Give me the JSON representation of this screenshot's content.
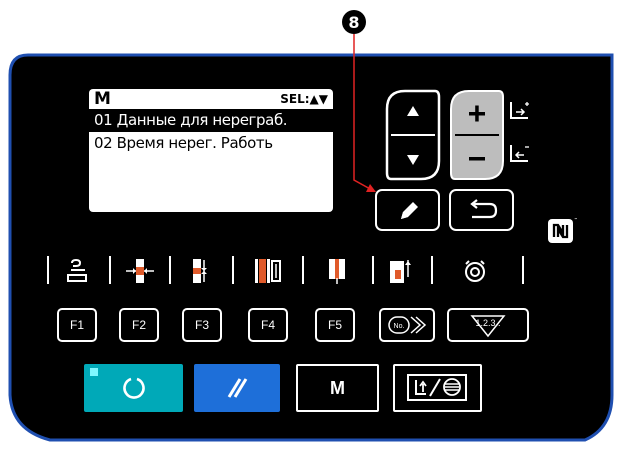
{
  "callout": {
    "number": "8"
  },
  "lcd": {
    "mode": "M",
    "sel_label": "SEL:▲▼",
    "rows": [
      {
        "text": "01 Данные для нерегpаб."
      },
      {
        "text": "02 Время нерег. Работь"
      }
    ]
  },
  "fkeys": [
    {
      "label": "F1"
    },
    {
      "label": "F2"
    },
    {
      "label": "F3"
    },
    {
      "label": "F4"
    },
    {
      "label": "F5"
    }
  ],
  "no_key": {
    "label": "No."
  },
  "counter_key": {
    "label": "1.2.3.."
  },
  "m_key": {
    "label": "M"
  },
  "colors": {
    "panel": "#000000",
    "panel_border": "#1f4fb0",
    "ready_button": "#00a9b8",
    "reset_button": "#1e6fd9",
    "plus_minus": "#bdbdbd",
    "callout_line": "#e02222"
  }
}
